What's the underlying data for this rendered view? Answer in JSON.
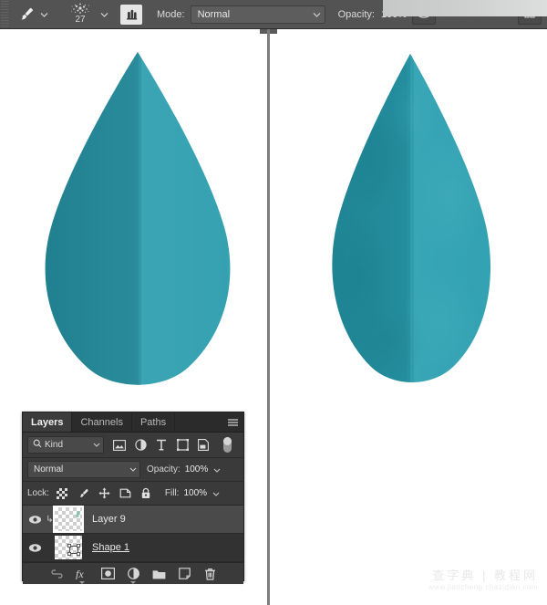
{
  "options_bar": {
    "brush_tool_icon": "brush-icon",
    "brush_preset_size": "27",
    "airbrush_icon": "airbrush-icon",
    "mode_label": "Mode:",
    "mode_value": "Normal",
    "opacity_label": "Opacity:",
    "opacity_value": "100%",
    "pressure_opacity_icon": "pressure-opacity-icon",
    "symmetry_icon": "symmetry-icon"
  },
  "canvas": {
    "left_droplet": {
      "name": "water-droplet-flat",
      "dark_fill": "#238291",
      "light_fill": "#3ba5b5"
    },
    "right_droplet": {
      "name": "water-droplet-textured",
      "dark_fill": "#218a9b",
      "light_fill": "#38a6b6"
    }
  },
  "layers_panel": {
    "tabs": [
      {
        "label": "Layers",
        "active": true
      },
      {
        "label": "Channels",
        "active": false
      },
      {
        "label": "Paths",
        "active": false
      }
    ],
    "menu_icon": "panel-menu-icon",
    "filter": {
      "search_icon": "search-icon",
      "kind_value": "Kind",
      "icons": [
        "pixel-layer-filter-icon",
        "adjustment-layer-filter-icon",
        "type-layer-filter-icon",
        "shape-layer-filter-icon",
        "smart-object-filter-icon"
      ],
      "toggle_icon": "filter-toggle-switch"
    },
    "blend": {
      "mode_value": "Normal",
      "opacity_label": "Opacity:",
      "opacity_value": "100%"
    },
    "lock": {
      "label": "Lock:",
      "icons": [
        "lock-transparent-pixels-icon",
        "lock-image-pixels-icon",
        "lock-position-icon",
        "lock-artboard-nesting-icon",
        "lock-all-icon"
      ],
      "fill_label": "Fill:",
      "fill_value": "100%"
    },
    "layers": [
      {
        "name": "Layer 9",
        "visible": true,
        "selected": true,
        "clipped": true,
        "underline": false,
        "thumb": "transparent-checker-thumb"
      },
      {
        "name": "Shape 1",
        "visible": true,
        "selected": false,
        "clipped": false,
        "underline": true,
        "thumb": "shape-vector-thumb"
      }
    ],
    "footer_icons": [
      "link-layers-icon",
      "layer-style-fx-icon",
      "add-layer-mask-icon",
      "new-adjustment-layer-icon",
      "new-group-icon",
      "new-layer-icon",
      "delete-layer-icon"
    ]
  },
  "watermark": {
    "text": "查字典 | 教程网",
    "url": "www.jiaocheng.chazidian.com"
  }
}
